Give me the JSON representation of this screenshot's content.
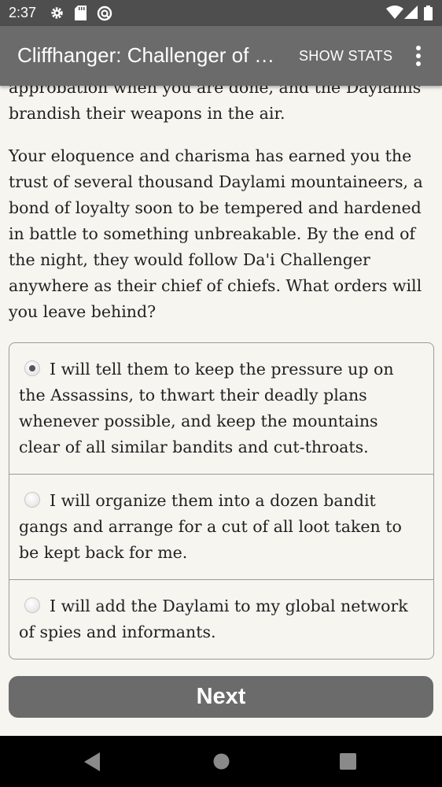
{
  "status_bar": {
    "time": "2:37",
    "icons": [
      "gear-icon",
      "sd-card-icon",
      "circle-at-icon",
      "wifi-icon",
      "signal-icon",
      "battery-icon"
    ]
  },
  "app_bar": {
    "title": "Cliffhanger: Challenger of Tomorrow",
    "show_stats_label": "SHOW STATS",
    "menu_icon": "more-vert-icon"
  },
  "story": {
    "partial_paragraph": "approbation when you are done, and the Daylamis brandish their weapons in the air.",
    "paragraph": "Your eloquence and charisma has earned you the trust of several thousand Daylami mountaineers, a bond of loyalty soon to be tempered and hardened in battle to something unbreakable. By the end of the night, they would follow Da'i Challenger anywhere as their chief of chiefs. What orders will you leave behind?"
  },
  "choices": [
    {
      "label": "I will tell them to keep the pressure up on the Assassins, to thwart their deadly plans whenever possible, and keep the mountains clear of all similar bandits and cut-throats.",
      "selected": true
    },
    {
      "label": "I will organize them into a dozen bandit gangs and arrange for a cut of all loot taken to be kept back for me.",
      "selected": false
    },
    {
      "label": "I will add the Daylami to my global network of spies and informants.",
      "selected": false
    }
  ],
  "next_label": "Next",
  "nav_bar": {
    "icons": [
      "back-triangle-icon",
      "home-circle-icon",
      "recents-square-icon"
    ]
  },
  "colors": {
    "status_bar": "#4e4e4e",
    "app_bar": "#6b6b6b",
    "background": "#f7f5f0",
    "button": "#6b6b6b",
    "text": "#222222"
  }
}
